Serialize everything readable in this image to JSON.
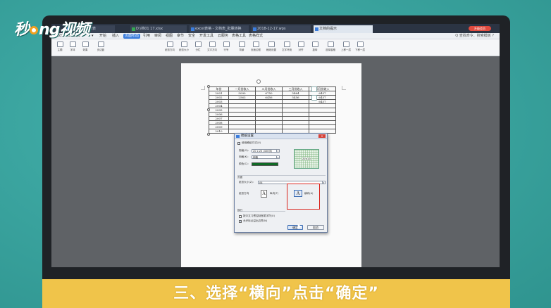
{
  "brand": {
    "logo_prefix": "秒",
    "logo_mid": "ng",
    "logo_suffix": "视频"
  },
  "window": {
    "tabs": [
      {
        "label": "按时间订货单表"
      },
      {
        "label": "D:\\档01 17.xlsx"
      },
      {
        "label": "excel表格 - 文档表_批量转换"
      },
      {
        "label": "2018-12-17.wps"
      },
      {
        "label": "文档的提示"
      }
    ],
    "user_badge": "升级会员"
  },
  "menu": {
    "items": [
      "三",
      "文件",
      "日",
      "日",
      "日",
      "↶",
      "↷",
      "▾",
      "开始",
      "插入",
      "页面布局",
      "引用",
      "审阅",
      "视图",
      "章节",
      "安全",
      "开发工具",
      "云服务",
      "表格工具",
      "表格样式"
    ],
    "active_index": 10,
    "help": "Q 查找命令、搜索模板  ?"
  },
  "ribbon": {
    "buttons": [
      "主题",
      "字体",
      "效果",
      "页边距",
      "纸张方向",
      "纸张大小",
      "分栏",
      "文字方向",
      "行号",
      "背景",
      "页面边框",
      "稿纸设置",
      "文字环绕",
      "对齐",
      "旋转",
      "选择窗格",
      "上移一层",
      "下移一层"
    ]
  },
  "table": {
    "headers": [
      "年份",
      "一月份收入",
      "二月份收入",
      "三月份收入",
      "四月份收入"
    ],
    "rows": [
      [
        "2001",
        "5090",
        "6750",
        "5464",
        "6457"
      ],
      [
        "2002",
        "2563",
        "6456",
        "5456",
        "6457"
      ],
      [
        "2003",
        "",
        "",
        "",
        "6457"
      ],
      [
        "2004",
        "",
        "",
        "",
        ""
      ],
      [
        "2005",
        "",
        "",
        "",
        ""
      ],
      [
        "2006",
        "",
        "",
        "",
        ""
      ],
      [
        "2007",
        "",
        "",
        "",
        ""
      ],
      [
        "2008",
        "",
        "",
        "",
        ""
      ],
      [
        "2009",
        "",
        "",
        "",
        ""
      ],
      [
        "2010",
        "",
        "",
        "",
        ""
      ]
    ]
  },
  "dialog": {
    "title": "稿纸设置",
    "close": "×",
    "use_paper_label": "使用稿纸方式(U)",
    "spec_label": "规格(G):",
    "spec_value": "20 x 20 (400字)",
    "grid_label": "网格(K):",
    "grid_value": "网格",
    "color_label": "颜色(C):",
    "preview_caption": "20×20",
    "page_section": "页面",
    "paper_size_label": "纸张大小(Z):",
    "paper_size_value": "A4",
    "orientation_label": "纸张方向",
    "portrait_label": "纵向(T)",
    "landscape_label": "横向(A)",
    "portrait_glyph": "A",
    "landscape_glyph": "A",
    "break_section": "换行",
    "opt1_label": "按中文习惯控制首尾字符(U)",
    "opt2_label": "允许标点溢出边界(N)",
    "ok": "确定",
    "cancel": "取消",
    "accent_color": "#d9231c"
  },
  "caption": "三、选择“横向”点击“确定”",
  "colors": {
    "background": "#3aa7a3",
    "caption_bar": "#f0c44a",
    "grid_color": "#0f6a25",
    "highlight": "#d9231c"
  }
}
